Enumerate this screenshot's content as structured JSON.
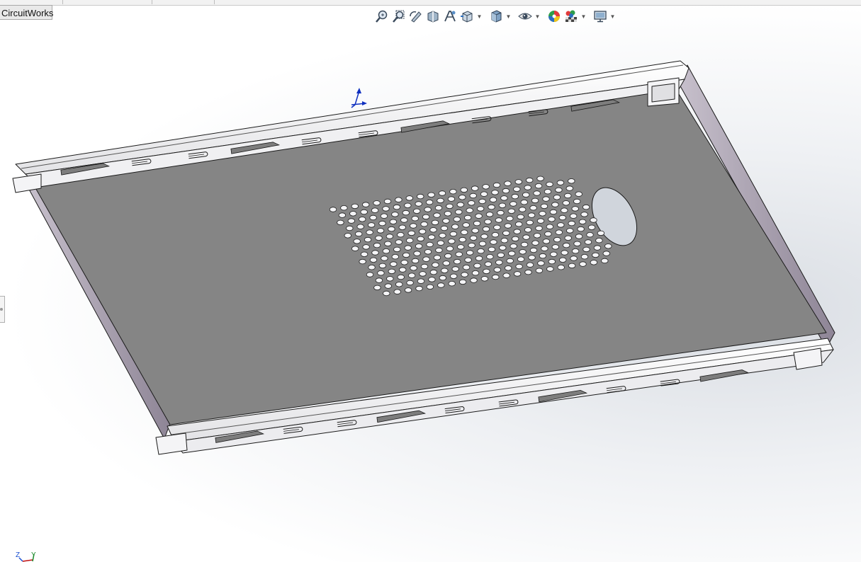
{
  "app": {
    "tab_label": "CircuitWorks"
  },
  "heads_up_toolbar": {
    "tools": [
      {
        "name": "zoom-to-fit-icon"
      },
      {
        "name": "zoom-to-area-icon"
      },
      {
        "name": "previous-view-icon"
      },
      {
        "name": "section-view-icon"
      },
      {
        "name": "dynamic-annotation-view-icon"
      },
      {
        "name": "view-orientation-icon",
        "dropdown": true
      },
      {
        "name": "display-style-icon",
        "dropdown": true
      },
      {
        "name": "hide-show-items-icon",
        "dropdown": true
      },
      {
        "name": "edit-appearance-icon"
      },
      {
        "name": "apply-scene-icon",
        "dropdown": true
      },
      {
        "name": "view-settings-icon",
        "dropdown": true
      }
    ]
  },
  "model": {
    "description_colors": {
      "panel_face": "#858585",
      "flange": "#f4f4f4",
      "edge": "#1a1a1a",
      "side_wall": "#a39aa8"
    },
    "vent_rows": 14,
    "vent_cols": 22
  },
  "triad": {
    "z_label": "Z",
    "y_label": "Y"
  }
}
